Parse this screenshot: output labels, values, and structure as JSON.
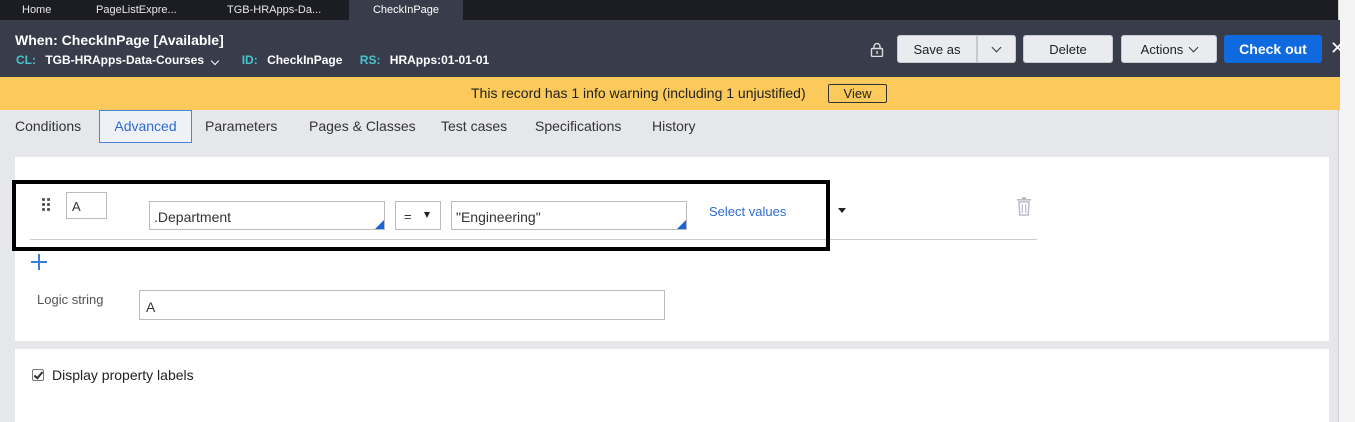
{
  "tabs": [
    "Home",
    "PageListExpre...",
    "TGB-HRApps-Da...",
    "CheckInPage"
  ],
  "header": {
    "title": "When: CheckInPage [Available]",
    "cl_label": "CL:",
    "cl_value": "TGB-HRApps-Data-Courses",
    "id_label": "ID:",
    "id_value": "CheckInPage",
    "rs_label": "RS:",
    "rs_value": "HRApps:01-01-01",
    "buttons": {
      "save_as": "Save as",
      "delete": "Delete",
      "actions": "Actions",
      "check_out": "Check out",
      "close": "✕"
    }
  },
  "warning": {
    "text": "This record has 1 info warning (including 1 unjustified)",
    "view_label": "View"
  },
  "subtabs": [
    "Conditions",
    "Advanced",
    "Parameters",
    "Pages & Classes",
    "Test cases",
    "Specifications",
    "History"
  ],
  "active_subtab": "Advanced",
  "condition": {
    "label": "A",
    "property": ".Department",
    "operator": "=",
    "value": "\"Engineering\"",
    "select_values_link": "Select values"
  },
  "logic": {
    "label": "Logic string",
    "value": "A"
  },
  "options": {
    "display_property_labels": "Display property labels",
    "checked": true
  },
  "colors": {
    "header_bg": "#393c4a",
    "warning_bg": "#fcca5a",
    "primary_button": "#0f6ae0",
    "meta_key": "#48c4ce",
    "link": "#2f6bd0"
  }
}
